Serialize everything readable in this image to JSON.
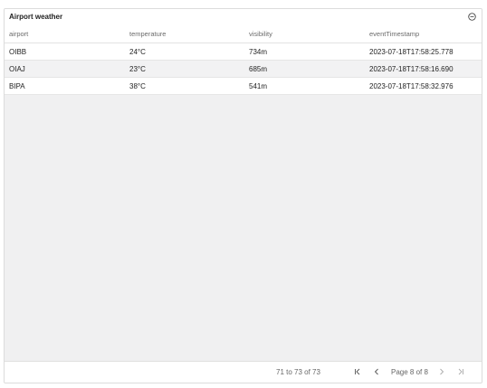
{
  "panel": {
    "title": "Airport weather"
  },
  "table": {
    "columns": [
      "airport",
      "temperature",
      "visibility",
      "eventTimestamp"
    ],
    "rows": [
      [
        "OIBB",
        "24°C",
        "734m",
        "2023-07-18T17:58:25.778"
      ],
      [
        "OIAJ",
        "23°C",
        "685m",
        "2023-07-18T17:58:16.690"
      ],
      [
        "BIPA",
        "38°C",
        "541m",
        "2023-07-18T17:58:32.976"
      ]
    ]
  },
  "pagination": {
    "range_text": "71 to 73 of 73",
    "page_text": "Page 8 of 8",
    "current_page": 8,
    "total_pages": 8
  },
  "icons": {
    "collapse": "minus-circle-icon",
    "first": "first-page-icon",
    "prev": "previous-page-icon",
    "next": "next-page-icon",
    "last": "last-page-icon"
  }
}
